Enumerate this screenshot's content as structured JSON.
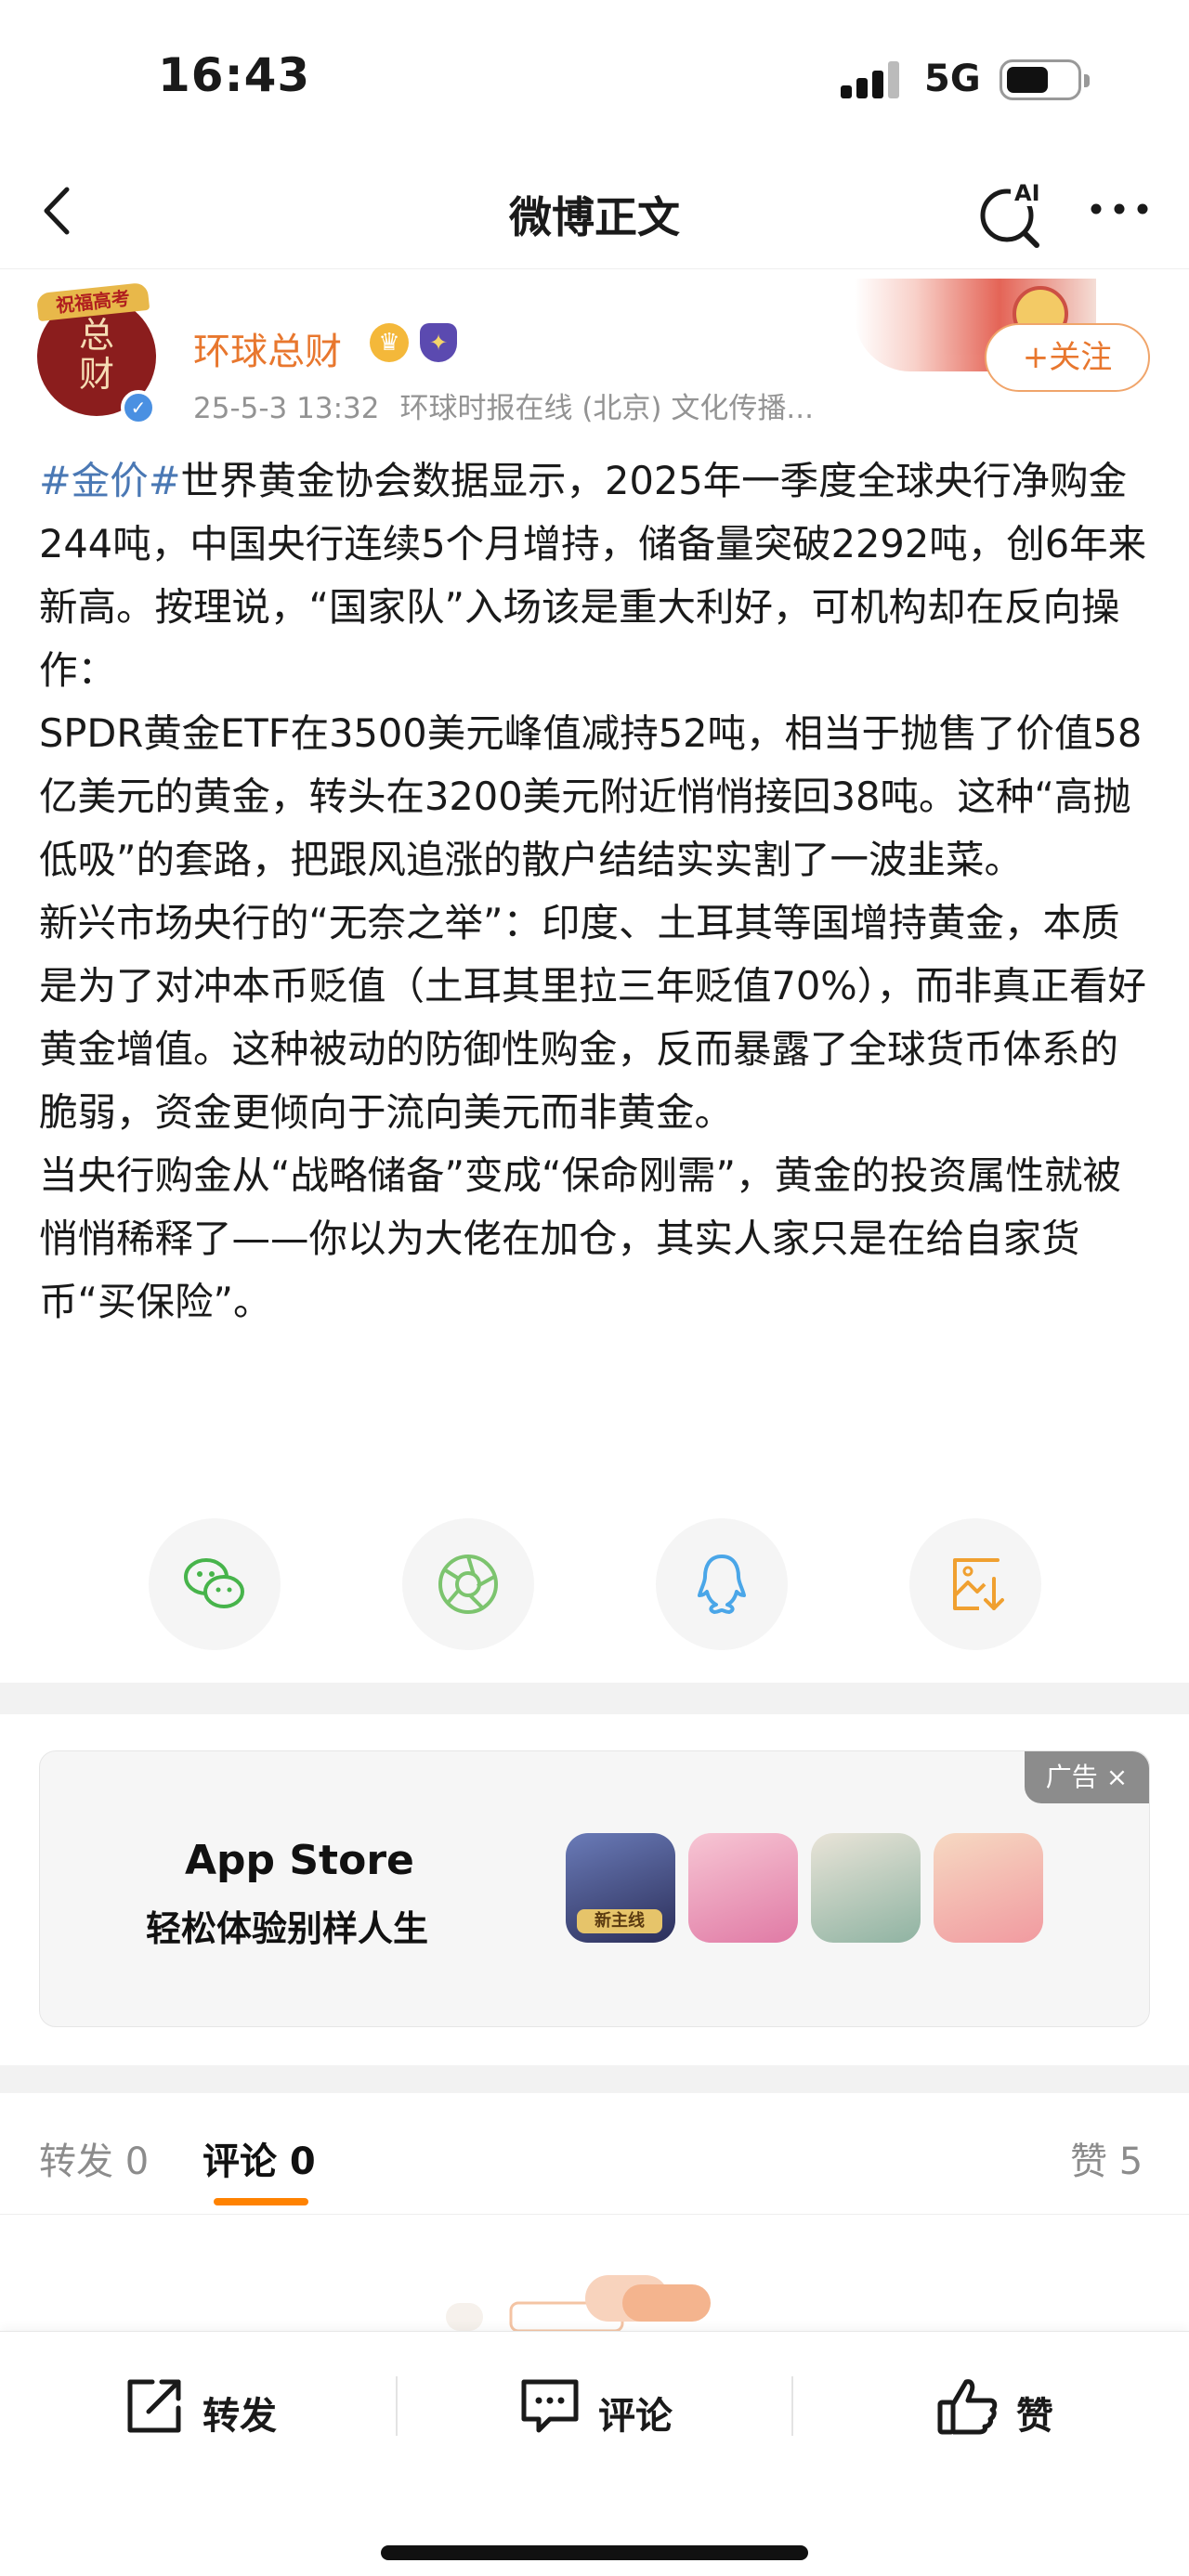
{
  "status_bar": {
    "time": "16:43",
    "network": "5G"
  },
  "nav": {
    "title": "微博正文",
    "ai_label": "AI"
  },
  "author": {
    "avatar_text": "总财",
    "avatar_banner": "祝福高考",
    "name": "环球总财",
    "date": "25-5-3 13:32",
    "source": "环球时报在线 (北京) 文化传播...",
    "follow_label": "+关注"
  },
  "post": {
    "hashtag": "#金价#",
    "paragraphs": [
      "世界黄金协会数据显示，2025年一季度全球央行净购金244吨，中国央行连续5个月增持，储备量突破2292吨，创6年来新高。按理说，“国家队”入场该是重大利好，可机构却在反向操作：",
      "SPDR黄金ETF在3500美元峰值减持52吨，相当于抛售了价值58亿美元的黄金，转头在3200美元附近悄悄接回38吨。这种“高抛低吸”的套路，把跟风追涨的散户结结实实割了一波韭菜。",
      "新兴市场央行的“无奈之举”：印度、土耳其等国增持黄金，本质是为了对冲本币贬值（土耳其里拉三年贬值70%），而非真正看好黄金增值。这种被动的防御性购金，反而暴露了全球货币体系的脆弱，资金更倾向于流向美元而非黄金。",
      "当央行购金从“战略储备”变成“保命刚需”，黄金的投资属性就被悄悄稀释了——你以为大佬在加仓，其实人家只是在给自家货币“买保险”。"
    ]
  },
  "share": {
    "icons": [
      "wechat-icon",
      "moments-icon",
      "qq-icon",
      "save-image-icon"
    ]
  },
  "ad": {
    "tag": "广告",
    "close": "×",
    "brand": "App Store",
    "slogan": "轻松体验别样人生",
    "game_badge": "新主线"
  },
  "tabs": {
    "repost": "转发 0",
    "comment": "评论 0",
    "like": "赞 5"
  },
  "bottom_bar": {
    "repost": "转发",
    "comment": "评论",
    "like": "赞"
  },
  "colors": {
    "accent_orange": "#ff8200",
    "author_name": "#e8772e",
    "hashtag_blue": "#4a78b4"
  }
}
